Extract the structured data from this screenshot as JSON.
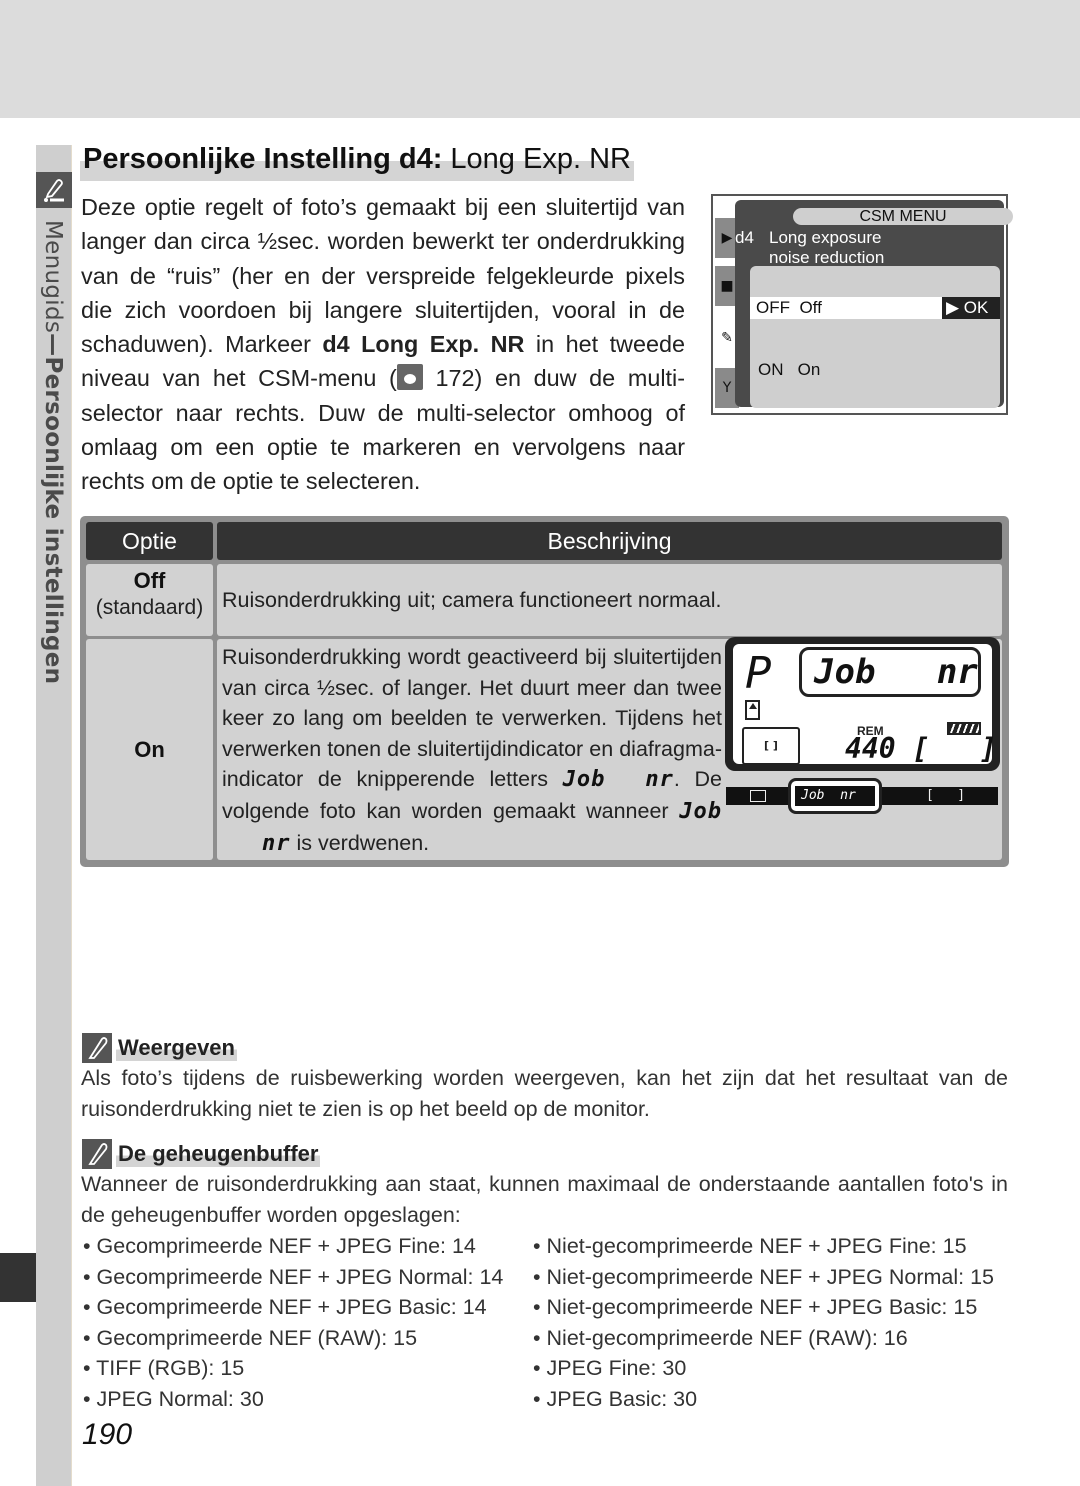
{
  "page": {
    "number": "190",
    "section_tab": {
      "label_prefix": "Menugids",
      "label_dash": "—",
      "label_bold": "Persoonlijke instellingen",
      "icon": "pencil-icon"
    }
  },
  "title": {
    "bold": "Persoonlijke Instelling d4:",
    "regular": " Long Exp. NR"
  },
  "intro": {
    "part1": "Deze optie regelt of foto’s gemaakt bij een sluitertijd van langer dan circa ½sec. worden bewerkt ter onderdrukking van de “ruis” (her en der verspreide felgekleurde pixels die zich voordoen bij langere sluitertijden, vooral in de schaduwen). Markeer ",
    "bold": "d4 Long Exp. NR",
    "part2": " in het tweede niveau van het CSM-menu (",
    "ref_icon": "eye-reference-icon",
    "ref_page": " 172",
    "part3": ") en duw de multi-selector naar rechts. Duw de multi-selector omhoog of omlaag om een optie te markeren en vervolgens naar rechts om de optie te selecteren."
  },
  "csm_menu": {
    "header": "CSM MENU",
    "item_code": "d4",
    "item_line1": "Long exposure",
    "item_line2": "noise reduction",
    "tab_icons": [
      "playback-icon",
      "camera-icon",
      "pencil-icon",
      "wrench-icon"
    ],
    "options": [
      {
        "code": "OFF",
        "label": "Off",
        "selected": true,
        "action": "OK"
      },
      {
        "code": "ON",
        "label": "On",
        "selected": false
      }
    ]
  },
  "table": {
    "headers": [
      "Optie",
      "Beschrijving"
    ],
    "rows": [
      {
        "option": "Off",
        "option_sub": "(standaard)",
        "description": "Ruisonderdrukking uit; camera functioneert normaal."
      },
      {
        "option": "On",
        "description_part1": "Ruisonderdrukking wordt geactiveerd bij sluitertijden van circa ½sec. of langer. Het duurt meer dan twee keer zo lang om beelden te verwerken. Tijdens het verwerken tonen de sluitertijdindicator en diafragma-indicator de knipperende letters ",
        "seg_job": "Job",
        "seg_nr": "nr",
        "description_part2": ". De volgende foto kan worden gemaakt wanneer ",
        "description_part3": " is verdwenen."
      }
    ]
  },
  "lcd": {
    "mode": "P",
    "display": "Job   nr",
    "rem_label": "REM",
    "count": "440 [   ]",
    "area_mark": "[ ]",
    "viewfinder_display": "Job  nr",
    "viewfinder_count": "[   ]"
  },
  "notes": [
    {
      "icon": "pencil-icon",
      "title": "Weergeven",
      "text": "Als foto’s tijdens de ruisbewerking worden weergeven, kan het zijn dat het resultaat van de ruisonderdrukking niet te zien is op het beeld op de monitor."
    },
    {
      "icon": "pencil-icon",
      "title": "De geheugenbuffer",
      "text": "Wanneer de ruisonderdrukking aan staat, kunnen maximaal de onderstaande aantallen foto's in de geheugenbuffer worden opgeslagen:"
    }
  ],
  "buffer_list": [
    [
      "Gecomprimeerde NEF + JPEG Fine: 14",
      "Niet-gecomprimeerde NEF + JPEG Fine: 15"
    ],
    [
      "Gecomprimeerde NEF + JPEG Normal: 14",
      "Niet-gecomprimeerde NEF + JPEG Normal: 15"
    ],
    [
      "Gecomprimeerde NEF + JPEG Basic: 14",
      "Niet-gecomprimeerde NEF + JPEG Basic: 15"
    ],
    [
      "Gecomprimeerde NEF (RAW): 15",
      "Niet-gecomprimeerde NEF (RAW): 16"
    ],
    [
      "TIFF (RGB): 15",
      "JPEG Fine: 30"
    ],
    [
      "JPEG Normal: 30",
      "JPEG Basic: 30"
    ]
  ]
}
